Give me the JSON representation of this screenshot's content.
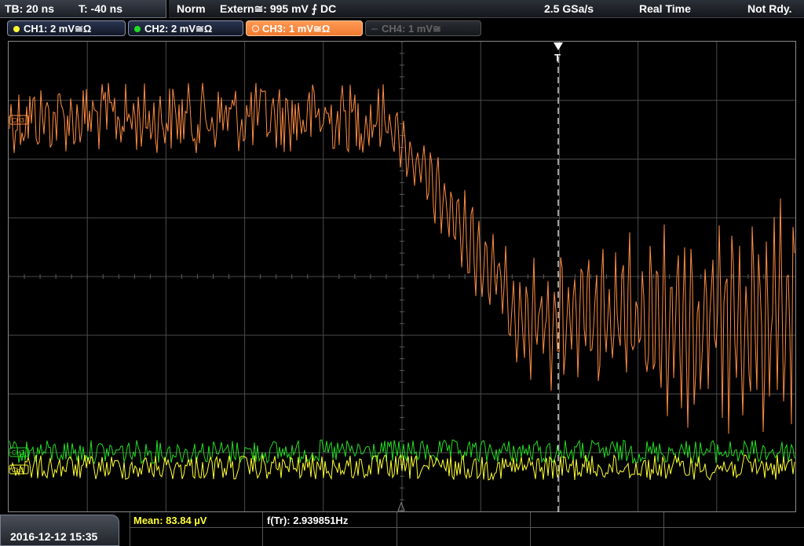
{
  "timebase": {
    "tb": "TB: 20 ns",
    "trigger_time": "T: -40 ns"
  },
  "status": {
    "trigger_mode": "Norm",
    "trigger_source": "Extern≅: 995 mV ⨍ DC",
    "sample_rate": "2.5 GSa/s",
    "acq_mode": "Real Time",
    "state": "Not Rdy."
  },
  "channels": [
    {
      "label": "CH1: 2 mV≅Ω",
      "color": "#ffff33",
      "active": true
    },
    {
      "label": "CH2: 2 mV≅Ω",
      "color": "#22dd22",
      "active": true
    },
    {
      "label": "CH3: 1 mV≅Ω",
      "color": "#ff8c42",
      "active": true
    },
    {
      "label": "CH4: 1 mV≅",
      "color": "#555555",
      "active": false
    }
  ],
  "markers": {
    "ch3": "CH3",
    "ch2": "CH2",
    "ch1": "CH1",
    "trigger": "T"
  },
  "measurements": {
    "mean": "Mean: 83.84 µV",
    "freq": "f(Tr): 2.939851Hz"
  },
  "timestamp": "2016-12-12 15:35",
  "colors": {
    "grid": "#5a5a5a",
    "ch1": "#ffff33",
    "ch2": "#22dd22",
    "ch3": "#ff8c42",
    "mean_text": "#ffff33"
  }
}
